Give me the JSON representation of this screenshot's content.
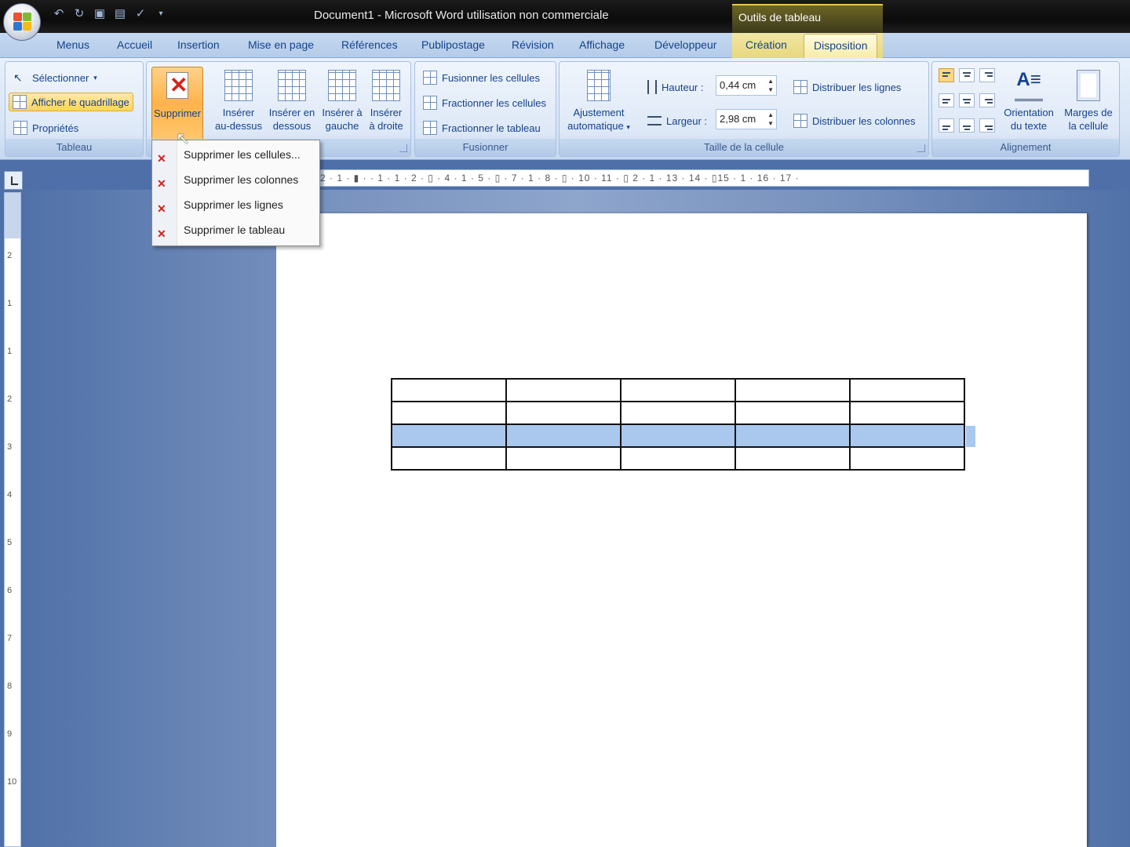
{
  "window": {
    "title": "Document1 - Microsoft Word utilisation non commerciale",
    "contextual_group": "Outils de tableau"
  },
  "tabs": [
    "Menus",
    "Accueil",
    "Insertion",
    "Mise en page",
    "Références",
    "Publipostage",
    "Révision",
    "Affichage",
    "Développeur",
    "Création",
    "Disposition"
  ],
  "active_tab": "Disposition",
  "ribbon": {
    "tableau": {
      "label": "Tableau",
      "selectionner": "Sélectionner",
      "afficher_quadrillage": "Afficher le quadrillage",
      "proprietes": "Propriétés"
    },
    "lignes_colonnes": {
      "supprimer": "Supprimer",
      "inserer_dessus_1": "Insérer",
      "inserer_dessus_2": "au-dessus",
      "inserer_dessous_1": "Insérer en",
      "inserer_dessous_2": "dessous",
      "inserer_gauche_1": "Insérer à",
      "inserer_gauche_2": "gauche",
      "inserer_droite_1": "Insérer",
      "inserer_droite_2": "à droite"
    },
    "fusionner": {
      "label": "Fusionner",
      "fusionner_cellules": "Fusionner les cellules",
      "fractionner_cellules": "Fractionner les cellules",
      "fractionner_tableau": "Fractionner le tableau"
    },
    "taille": {
      "label": "Taille de la cellule",
      "ajustement_1": "Ajustement",
      "ajustement_2": "automatique",
      "hauteur_label": "Hauteur :",
      "hauteur_value": "0,44 cm",
      "largeur_label": "Largeur :",
      "largeur_value": "2,98 cm",
      "distribuer_lignes": "Distribuer les lignes",
      "distribuer_colonnes": "Distribuer les colonnes"
    },
    "alignement": {
      "label": "Alignement",
      "orientation_1": "Orientation",
      "orientation_2": "du texte",
      "marges_1": "Marges de",
      "marges_2": "la cellule"
    }
  },
  "delete_menu": [
    "Supprimer les cellules...",
    "Supprimer les colonnes",
    "Supprimer les lignes",
    "Supprimer le tableau"
  ],
  "ruler": {
    "horizontal": "2 · 1 · ▮ · · 1 · 1 · 2 · ▯ · 4 · 1 · 5 · ▯ · 7 · 1 · 8 · ▯ · 10 · 11 · ▯ 2 · 1 · 13 · 14 · ▯15 · 1 · 16 · 17 ·",
    "vertical": [
      "2",
      "1",
      "1",
      "2",
      "3",
      "4",
      "5",
      "6",
      "7",
      "8",
      "9",
      "10"
    ]
  },
  "document": {
    "table": {
      "rows": 4,
      "columns": 5,
      "selected_row": 3
    }
  },
  "colors": {
    "accent": "#ffc76f",
    "selection": "#aac8ee",
    "contextual": "#e6c94d"
  }
}
